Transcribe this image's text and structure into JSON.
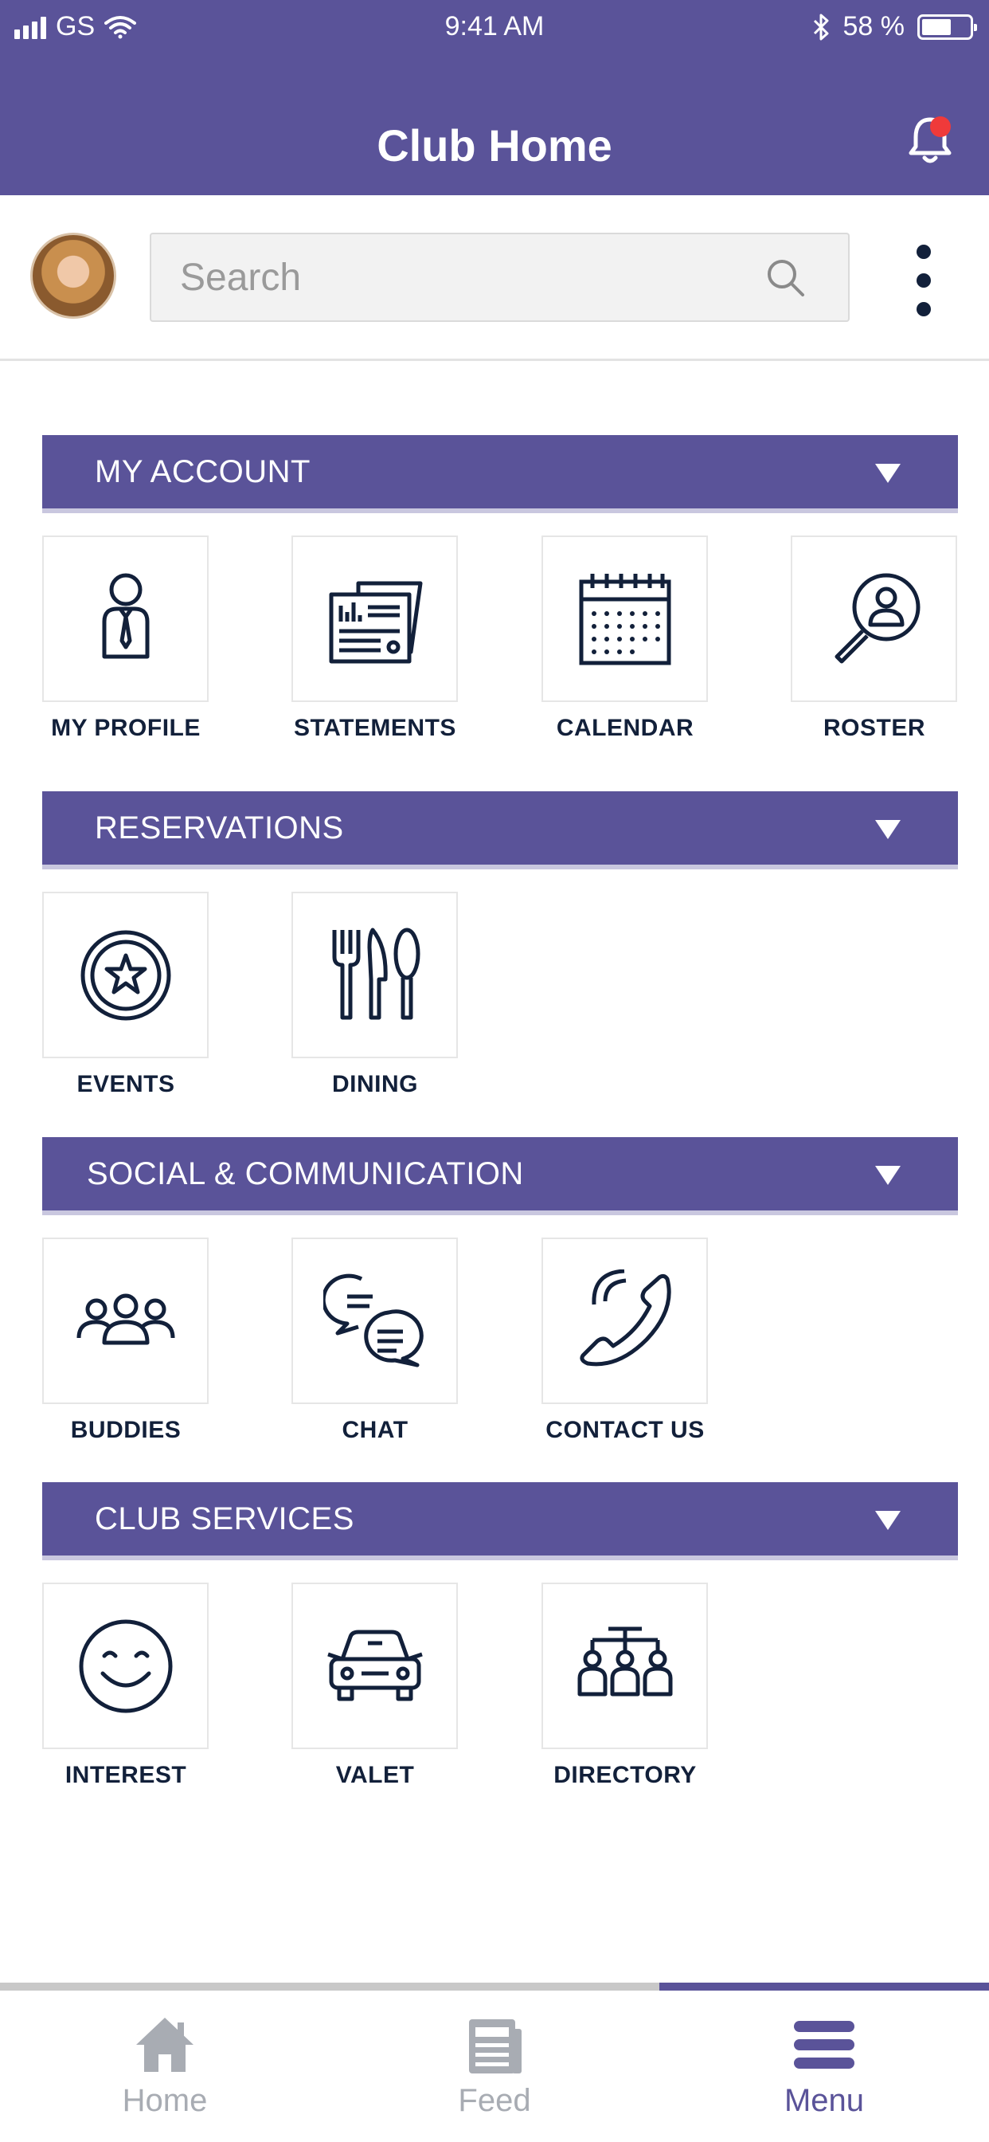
{
  "status_bar": {
    "carrier": "GS",
    "time": "9:41 AM",
    "battery": "58 %"
  },
  "header": {
    "title": "Club Home"
  },
  "search": {
    "placeholder": "Search"
  },
  "sections": [
    {
      "title": "MY ACCOUNT",
      "items": [
        {
          "label": "MY PROFILE",
          "icon": "profile-icon"
        },
        {
          "label": "STATEMENTS",
          "icon": "statements-icon"
        },
        {
          "label": "CALENDAR",
          "icon": "calendar-icon"
        },
        {
          "label": "ROSTER",
          "icon": "roster-icon"
        }
      ]
    },
    {
      "title": "RESERVATIONS",
      "items": [
        {
          "label": "EVENTS",
          "icon": "events-icon"
        },
        {
          "label": "DINING",
          "icon": "dining-icon"
        }
      ]
    },
    {
      "title": "SOCIAL & COMMUNICATION",
      "items": [
        {
          "label": "BUDDIES",
          "icon": "buddies-icon"
        },
        {
          "label": "CHAT",
          "icon": "chat-icon"
        },
        {
          "label": "CONTACT US",
          "icon": "phone-icon"
        }
      ]
    },
    {
      "title": "CLUB SERVICES",
      "items": [
        {
          "label": "INTEREST",
          "icon": "smiley-icon"
        },
        {
          "label": "VALET",
          "icon": "car-icon"
        },
        {
          "label": "DIRECTORY",
          "icon": "directory-icon"
        }
      ]
    }
  ],
  "bottom_nav": {
    "items": [
      {
        "label": "Home",
        "icon": "home-icon",
        "active": false
      },
      {
        "label": "Feed",
        "icon": "feed-icon",
        "active": false
      },
      {
        "label": "Menu",
        "icon": "menu-icon",
        "active": true
      }
    ]
  },
  "colors": {
    "primary": "#5a5399",
    "icon": "#12203a",
    "inactive": "#a8acb3",
    "notification": "#ef3a3a"
  }
}
